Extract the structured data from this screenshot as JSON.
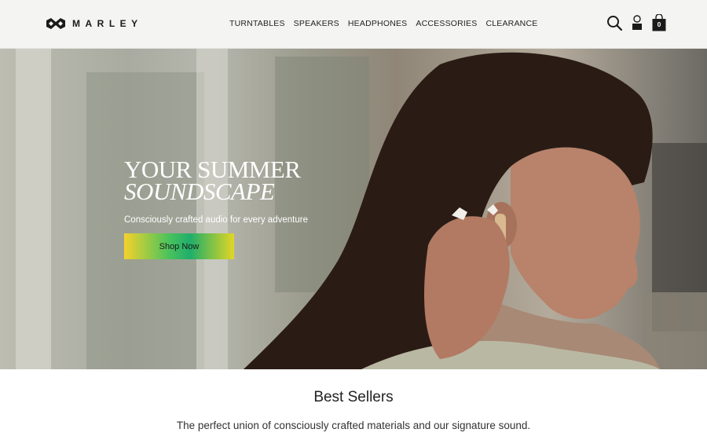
{
  "header": {
    "logo_text": "MARLEY",
    "nav": [
      "TURNTABLES",
      "SPEAKERS",
      "HEADPHONES",
      "ACCESSORIES",
      "CLEARANCE"
    ],
    "cart_count": "0"
  },
  "hero": {
    "title_line1": "YOUR SUMMER",
    "title_line2": "SOUNDSCAPE",
    "subtitle": "Consciously crafted audio for every adventure",
    "cta_label": "Shop Now"
  },
  "best_sellers": {
    "title": "Best Sellers",
    "description": "The perfect union of consciously crafted materials and our signature sound."
  },
  "icons": {
    "search": "search-icon",
    "account": "account-icon",
    "cart": "shopping-bag-icon"
  }
}
